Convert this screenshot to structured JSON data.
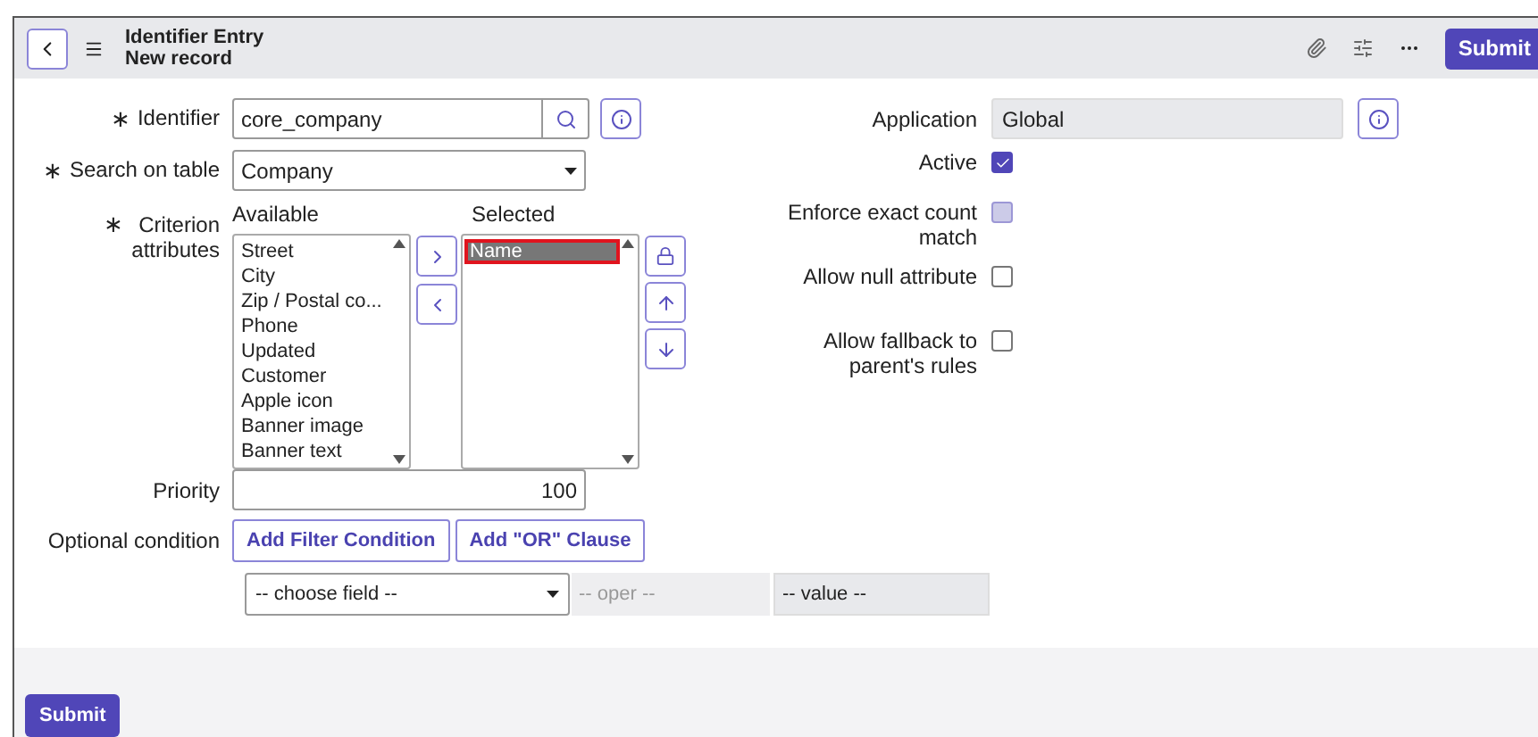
{
  "header": {
    "title": "Identifier Entry",
    "subtitle": "New record",
    "submit": "Submit"
  },
  "left_fields": {
    "identifier": {
      "label": "Identifier",
      "required_mark": "∗",
      "value": "core_company"
    },
    "search_table": {
      "label": "Search on table",
      "required_mark": "∗",
      "value": "Company"
    },
    "criterion": {
      "label": "Criterion attributes",
      "required_mark": "∗",
      "available_label": "Available",
      "selected_label": "Selected",
      "available": [
        {
          "label": "Street",
          "selected": false
        },
        {
          "label": "City",
          "selected": false
        },
        {
          "label": "Zip / Postal co...",
          "selected": false
        },
        {
          "label": "Phone",
          "selected": false
        },
        {
          "label": "Updated",
          "selected": false
        },
        {
          "label": "Customer",
          "selected": false
        },
        {
          "label": "Apple icon",
          "selected": false
        },
        {
          "label": "Banner image",
          "selected": false
        },
        {
          "label": "Banner text",
          "selected": false
        }
      ],
      "selected": [
        {
          "label": "Name",
          "selected": true,
          "highlighted": true
        }
      ]
    }
  },
  "right_fields": {
    "application": {
      "label": "Application",
      "value": "Global"
    },
    "checkboxes": [
      {
        "label": "Active",
        "checked": true,
        "disabled": false
      },
      {
        "label": "Enforce exact count match",
        "checked": false,
        "disabled": true
      },
      {
        "label": "Allow null attribute",
        "checked": false,
        "disabled": false
      },
      {
        "label": "Allow fallback to parent's rules",
        "checked": false,
        "disabled": false
      }
    ]
  },
  "priority": {
    "label": "Priority",
    "value": "100"
  },
  "optional_condition": {
    "label": "Optional condition",
    "buttons": [
      "Add Filter Condition",
      "Add \"OR\" Clause"
    ],
    "field": "-- choose field --",
    "oper": "-- oper --",
    "value": "-- value --"
  },
  "footer": {
    "submit": "Submit"
  }
}
